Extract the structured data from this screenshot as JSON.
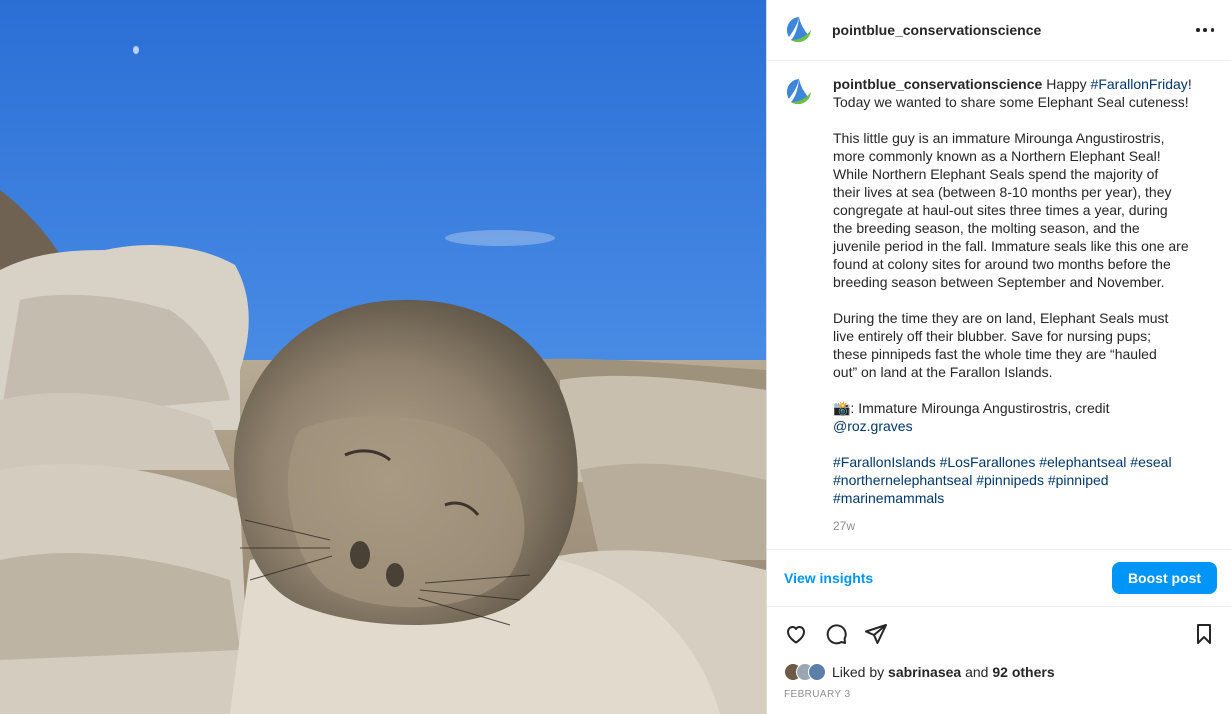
{
  "post": {
    "account": "pointblue_conservationscience",
    "more_options_icon": "more-horizontal-icon",
    "photo_alt": "Immature elephant seal resting on rocks"
  },
  "caption": {
    "username": "pointblue_conservationscience",
    "intro": "Happy",
    "hashtag_intro": "#FarallonFriday",
    "intro_tail": "!\nToday we wanted to share some Elephant Seal cuteness!",
    "para1": "This little guy is an immature Mirounga Angustirostris,\nmore commonly known as a Northern Elephant Seal!\nWhile Northern Elephant Seals spend the majority of\ntheir lives at sea (between 8-10 months per year), they\ncongregate at haul-out sites three times a year, during\nthe breeding season, the molting season, and the\njuvenile period in the fall. Immature seals like this one are\nfound at colony sites for around two months before the\nbreeding season between September and November.",
    "para2": "During the time they are on land, Elephant Seals must\nlive entirely off their blubber. Save for nursing pups;\nthese pinnipeds fast the whole time they are “hauled\nout” on land at the Farallon Islands.",
    "credit_text": "📸: Immature Mirounga Angustirostris, credit",
    "credit_handle": "@roz.graves",
    "hashtags_line1": "#FarallonIslands #LosFarallones #elephantseal #eseal",
    "hashtags_line2": "#northernelephantseal #pinnipeds #pinniped",
    "hashtags_line3": "#marinemammals",
    "time_ago": "27w"
  },
  "insights": {
    "view_label": "View insights",
    "boost_label": "Boost post"
  },
  "actions": {
    "like_icon": "heart-icon",
    "comment_icon": "comment-icon",
    "share_icon": "send-icon",
    "save_icon": "bookmark-icon"
  },
  "likes": {
    "prefix": "Liked by",
    "user": "sabrinasea",
    "and": "and",
    "others": "92 others"
  },
  "date": "FEBRUARY 3",
  "colors": {
    "accent": "#0095f6",
    "link": "#00376b",
    "logo_blue": "#3d86d9",
    "logo_green": "#6bbf45"
  }
}
